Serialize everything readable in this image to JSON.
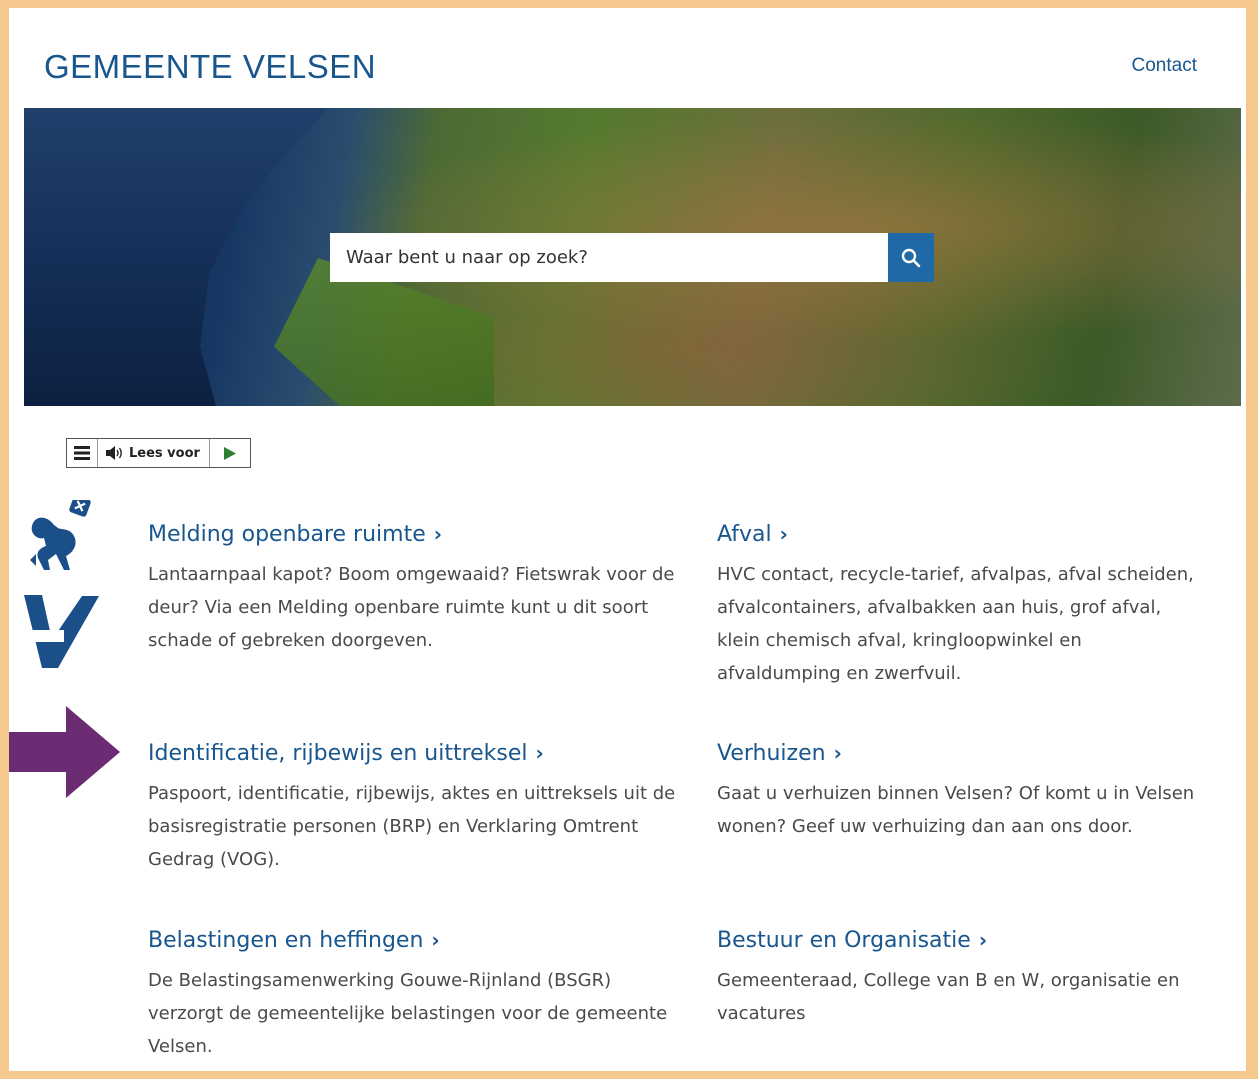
{
  "header": {
    "brand": "GEMEENTE VELSEN",
    "contact_label": "Contact"
  },
  "search": {
    "placeholder": "Waar bent u naar op zoek?",
    "button_icon": "search-icon"
  },
  "readspeaker": {
    "menu_icon": "hamburger-icon",
    "label": "Lees voor",
    "speaker_icon": "speaker-icon",
    "play_icon": "play-icon"
  },
  "colors": {
    "brand": "#19568e",
    "accent_button": "#1f6aa6",
    "frame": "#f5c98e",
    "arrow": "#6b2c74"
  },
  "cards": [
    {
      "title": "Melding openbare ruimte",
      "text": "Lantaarnpaal kapot? Boom omgewaaid? Fietswrak voor de deur? Via een Melding openbare ruimte kunt u dit soort schade of gebreken doorgeven."
    },
    {
      "title": "Afval",
      "text": "HVC contact, recycle-tarief, afvalpas, afval scheiden, afvalcontainers, afvalbakken aan huis, grof afval, klein chemisch afval, kringloopwinkel en afvaldumping en zwerfvuil."
    },
    {
      "title": "Identificatie, rijbewijs en uittreksel",
      "text": "Paspoort, identificatie, rijbewijs, aktes en uittreksels uit de basisregistratie personen (BRP) en Verklaring Omtrent Gedrag (VOG)."
    },
    {
      "title": "Verhuizen",
      "text": "Gaat u verhuizen binnen Velsen? Of komt u in Velsen wonen? Geef uw verhuizing dan aan ons door."
    },
    {
      "title": "Belastingen en heffingen",
      "text": "De Belastingsamenwerking Gouwe-Rijnland (BSGR) verzorgt de gemeentelijke belastingen voor de gemeente Velsen."
    },
    {
      "title": "Bestuur en Organisatie",
      "text": "Gemeenteraad, College van B en W, organisatie en vacatures"
    }
  ],
  "chevron": "›"
}
